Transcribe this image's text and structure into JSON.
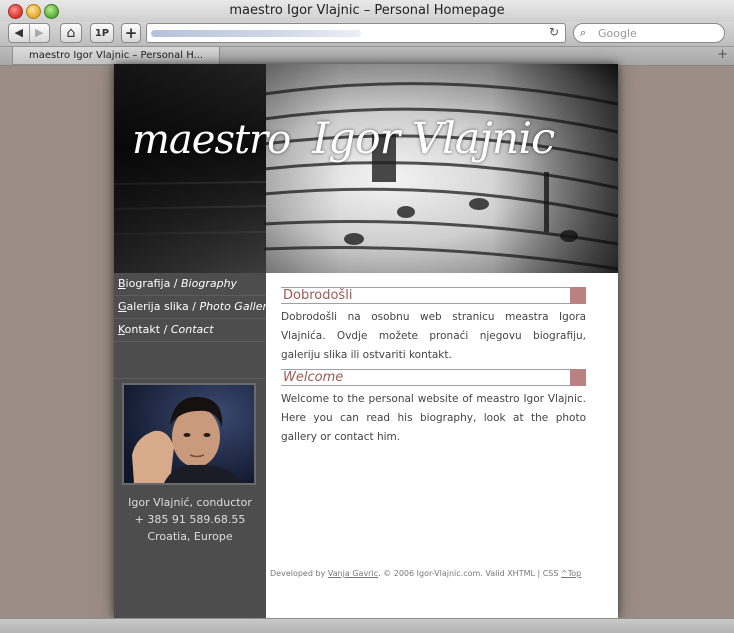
{
  "window": {
    "title": "maestro Igor Vlajnic – Personal Homepage"
  },
  "toolbar": {
    "back_glyph": "◀",
    "forward_glyph": "▶",
    "home_glyph": "⌂",
    "onepassword_label": "1P",
    "add_glyph": "+",
    "reload_glyph": "↻",
    "search_placeholder": "Google"
  },
  "tabs": [
    {
      "label": "maestro Igor Vlajnic – Personal H..."
    }
  ],
  "header": {
    "title_first": "maestro",
    "title_rest": "Igor Vlajnic"
  },
  "nav": [
    {
      "key": "B",
      "rest": "iografija / ",
      "en": "Biography"
    },
    {
      "key": "G",
      "rest": "alerija slika / ",
      "en": "Photo Gallery"
    },
    {
      "key": "K",
      "rest": "ontakt / ",
      "en": "Contact"
    }
  ],
  "contact": {
    "name": "Igor Vlajnić, conductor",
    "phone": "+ 385 91 589.68.55",
    "location": "Croatia, Europe"
  },
  "sections": {
    "croatian": {
      "title": "Dobrodošli",
      "text": "Dobrodošli na osobnu web stranicu meastra Igora Vlajnića. Ovdje možete pronaći njegovu biografiju, galeriju slika ili ostvariti kontakt."
    },
    "english": {
      "title": "Welcome",
      "text": "Welcome to the personal website of meastro Igor Vlajnic. Here you can read his biography, look at the photo gallery or contact him."
    }
  },
  "footer": {
    "developed_by": "Developed by ",
    "developer": "Vanja Gavric",
    "copyright": ". © 2006 Igor-Vlajnic.com. Valid XHTML | CSS ",
    "top_link": "^Top"
  },
  "colors": {
    "accent": "#b88282",
    "heading": "#9c5b56",
    "sidebar": "#4d4d4d",
    "backdrop": "#9c8e86"
  }
}
